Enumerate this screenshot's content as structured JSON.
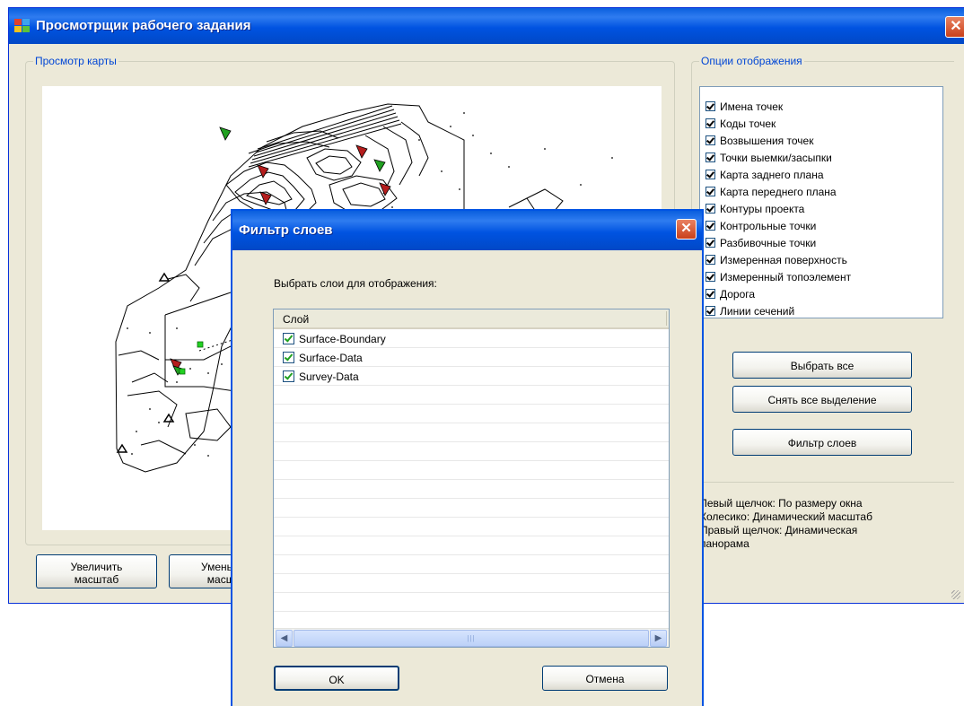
{
  "window": {
    "title": "Просмотрщик рабочего задания",
    "close_glyph": "✕"
  },
  "map_group": {
    "title": "Просмотр карты"
  },
  "options_group": {
    "title": "Опции отображения",
    "items": [
      {
        "label": "Имена точек",
        "checked": true
      },
      {
        "label": "Коды точек",
        "checked": true
      },
      {
        "label": "Возвышения точек",
        "checked": true
      },
      {
        "label": "Точки выемки/засыпки",
        "checked": true
      },
      {
        "label": "Карта заднего плана",
        "checked": true
      },
      {
        "label": "Карта переднего плана",
        "checked": true
      },
      {
        "label": "Контуры проекта",
        "checked": true
      },
      {
        "label": "Контрольные точки",
        "checked": true
      },
      {
        "label": "Разбивочные точки",
        "checked": true
      },
      {
        "label": "Измеренная поверхность",
        "checked": true
      },
      {
        "label": "Измеренный топоэлемент",
        "checked": true
      },
      {
        "label": "Дорога",
        "checked": true
      },
      {
        "label": "Линии сечений",
        "checked": true
      }
    ],
    "select_all": "Выбрать все",
    "deselect_all": "Снять все выделение",
    "layer_filter": "Фильтр слоев"
  },
  "hints": {
    "left_click": "Левый щелчок:     По размеру окна",
    "wheel": "Колесико: Динамический масштаб",
    "right_click": "Правый щелчок: Динамическая",
    "right_click_cont": "панорама"
  },
  "zoom": {
    "zoom_in_line1": "Увеличить",
    "zoom_in_line2": "масштаб",
    "zoom_out_line1": "Уменьшить",
    "zoom_out_line2": "масштаб"
  },
  "dialog": {
    "title": "Фильтр слоев",
    "prompt": "Выбрать слои для отображения:",
    "column_header": "Слой",
    "layers": [
      {
        "name": "Surface-Boundary",
        "checked": true
      },
      {
        "name": "Surface-Data",
        "checked": true
      },
      {
        "name": "Survey-Data",
        "checked": true
      }
    ],
    "ok": "OK",
    "cancel": "Отмена",
    "close_glyph": "✕",
    "scroll_left": "◀",
    "scroll_right": "▶",
    "scroll_grip": "|||"
  },
  "colors": {
    "title_bar": "#0053e1",
    "window_face": "#ece9d8",
    "group_title": "#0046d5",
    "close_button": "#d9532a",
    "marker_red": "#b51d1d",
    "marker_green": "#21a121"
  }
}
